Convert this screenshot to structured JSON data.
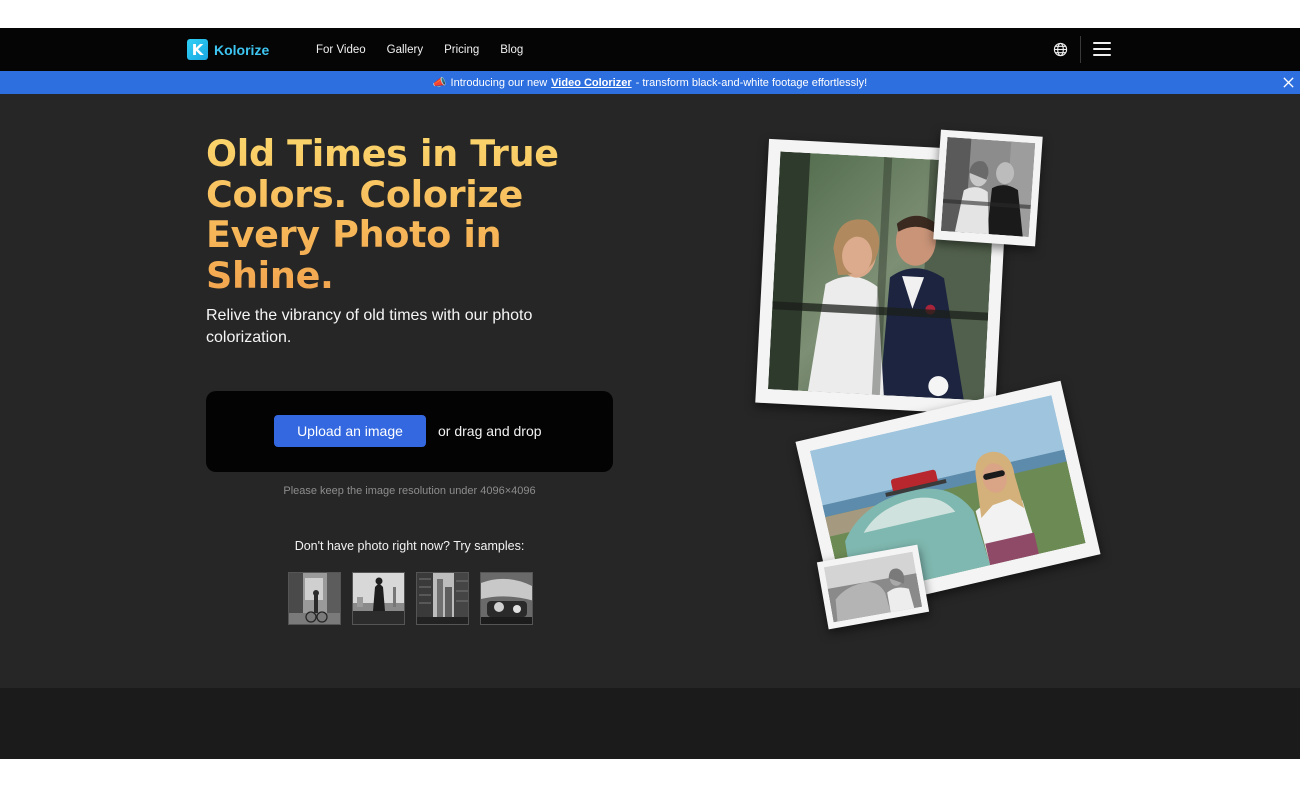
{
  "brand": {
    "logo_letter": "K",
    "name": "Kolorize",
    "accent": "#3ec6f2"
  },
  "nav": {
    "links": [
      "For Video",
      "Gallery",
      "Pricing",
      "Blog"
    ],
    "icons": [
      "globe-icon",
      "menu-icon"
    ]
  },
  "banner": {
    "prefix": "Introducing our new",
    "link": "Video Colorizer",
    "suffix": "- transform black-and-white footage effortlessly!",
    "color": "#2e6fdf"
  },
  "hero": {
    "headline": "Old Times in True Colors. Colorize Every Photo in Shine.",
    "subhead": "Relive the vibrancy of old times with our photo colorization.",
    "upload_button": "Upload an image",
    "drag_text": "or drag and drop",
    "hint": "Please keep the image resolution under 4096×4096",
    "samples_title": "Don't have photo right now? Try samples:",
    "samples": [
      "sample-street",
      "sample-skyline-person",
      "sample-city-buildings",
      "sample-car-interior"
    ]
  },
  "colors": {
    "headline_gold": "#f7b95a",
    "button_blue": "#3368e0",
    "hero_bg": "#262626"
  }
}
